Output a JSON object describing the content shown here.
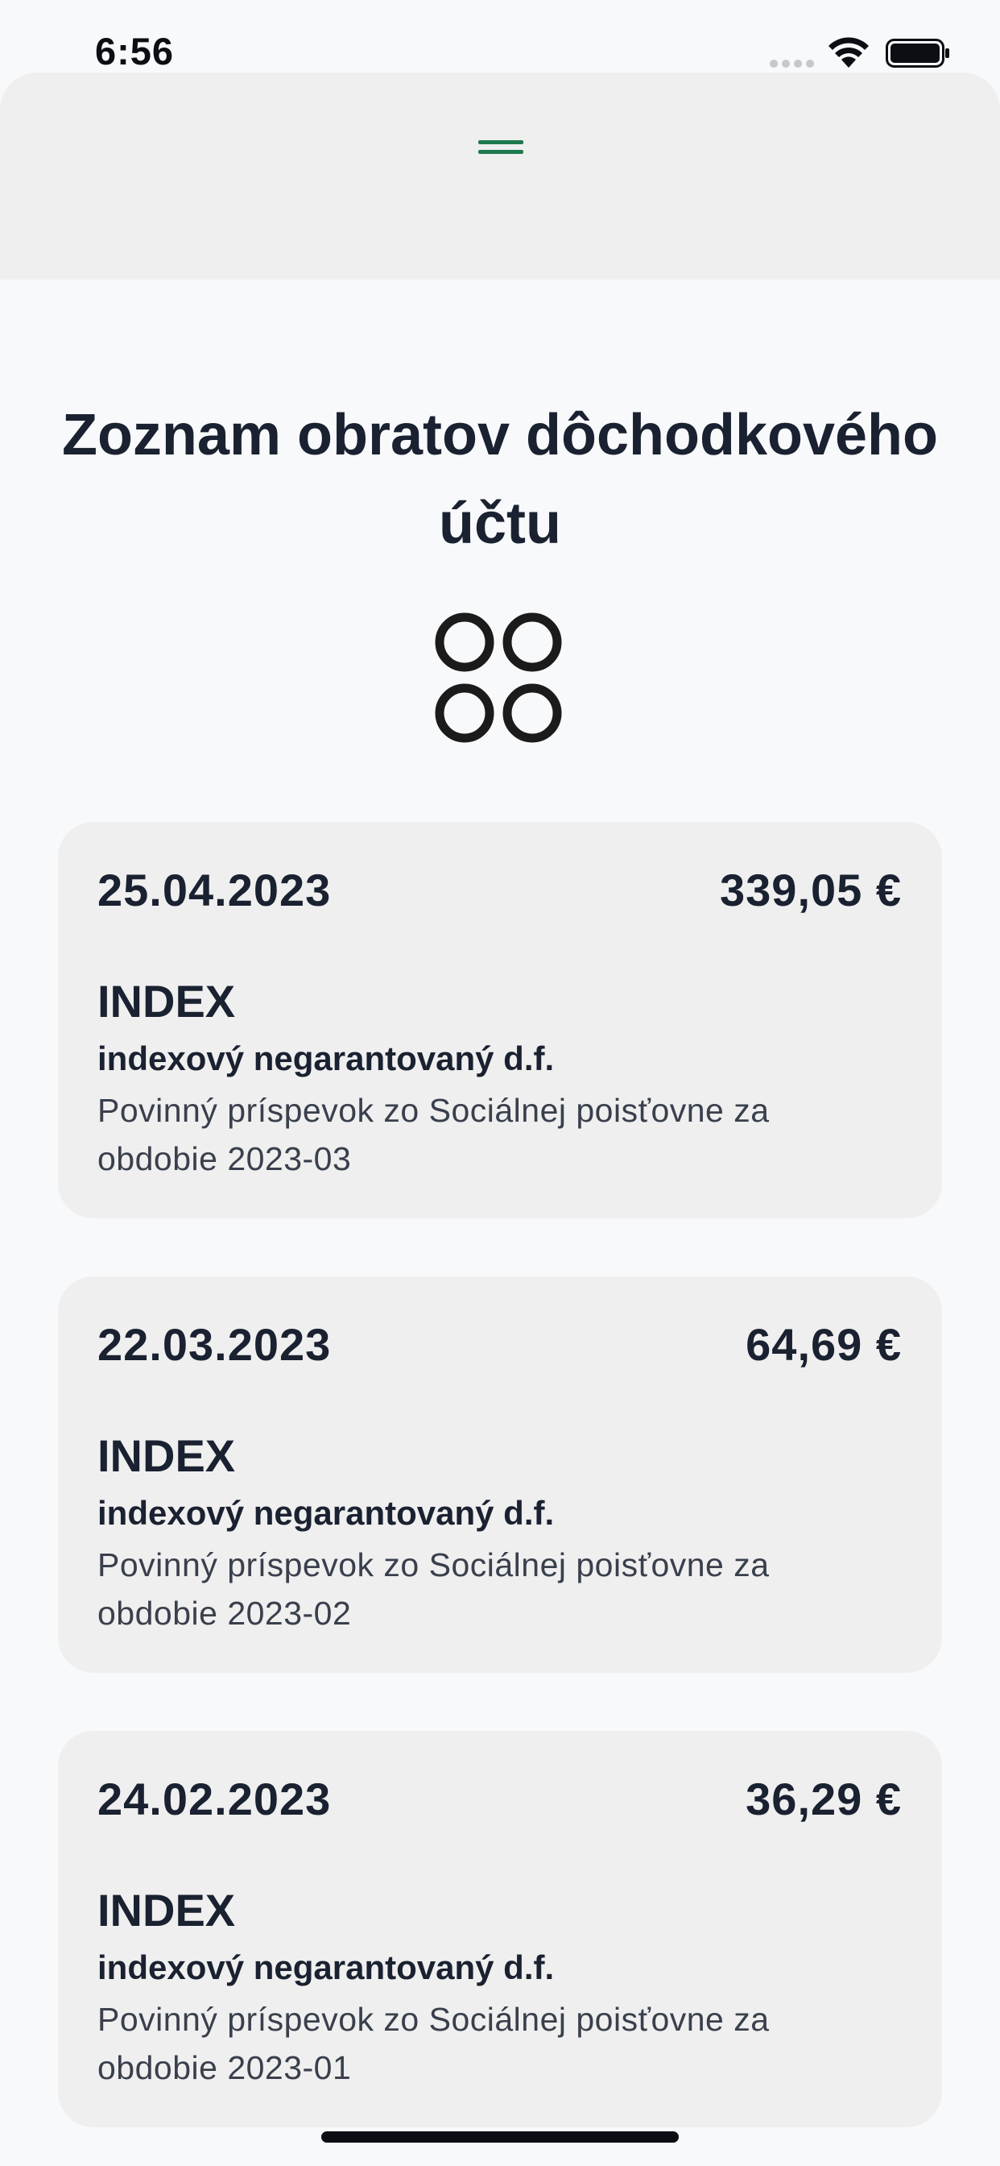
{
  "status_bar": {
    "time": "6:56"
  },
  "header": {
    "grabber_icon": "menu-lines-icon",
    "accent_color": "#1e7a4f"
  },
  "page": {
    "title": "Zoznam obratov dôchodkového účtu",
    "logo_icon": "four-circles-logo"
  },
  "transactions": [
    {
      "date": "25.04.2023",
      "amount": "339,05 €",
      "fund": "INDEX",
      "fund_subtitle": "indexový negarantovaný d.f.",
      "description": "Povinný príspevok zo Sociálnej poisťovne za obdobie 2023-03"
    },
    {
      "date": "22.03.2023",
      "amount": "64,69 €",
      "fund": "INDEX",
      "fund_subtitle": "indexový negarantovaný d.f.",
      "description": "Povinný príspevok zo Sociálnej poisťovne za obdobie 2023-02"
    },
    {
      "date": "24.02.2023",
      "amount": "36,29 €",
      "fund": "INDEX",
      "fund_subtitle": "indexový negarantovaný d.f.",
      "description": "Povinný príspevok zo Sociálnej poisťovne za obdobie 2023-01"
    }
  ]
}
